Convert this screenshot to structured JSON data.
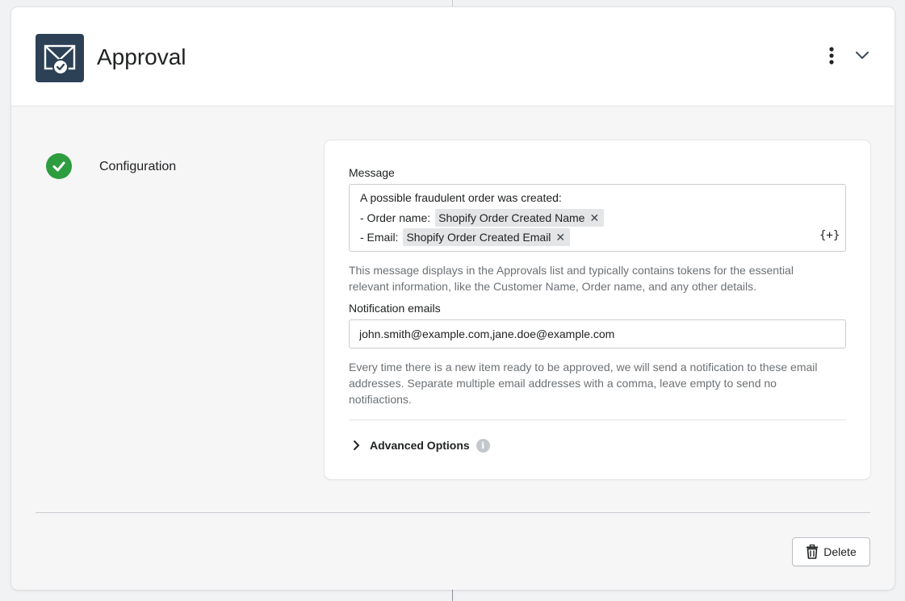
{
  "header": {
    "title": "Approval",
    "app_icon": "approval-envelope-icon",
    "menu_icon": "vertical-dots-icon",
    "collapse_icon": "chevron-down-icon"
  },
  "step": {
    "label": "Configuration",
    "status_icon": "check-circle-icon",
    "status_color": "#2d9d3f"
  },
  "message": {
    "label": "Message",
    "line1": "A possible fraudulent order was created:",
    "line2_prefix": "- Order name:",
    "line2_token": "Shopify Order Created Name",
    "line3_prefix": "- Email:",
    "line3_token": "Shopify Order Created Email",
    "token_remove_glyph": "✕",
    "insert_token_label": "{+}",
    "help_line1": "This message displays in the Approvals list and typically contains tokens for the essential",
    "help_line2": "relevant information, like the Customer Name, Order name, and any other details."
  },
  "notification": {
    "label": "Notification emails",
    "value": "john.smith@example.com,jane.doe@example.com",
    "help_line1": "Every time there is a new item ready to be approved, we will send a notification to these email",
    "help_line2": "addresses. Separate multiple email addresses with a comma, leave empty to send no",
    "help_line3": "notifiactions."
  },
  "advanced": {
    "label": "Advanced Options",
    "info_glyph": "i"
  },
  "footer": {
    "delete_label": "Delete",
    "delete_icon": "trash-icon"
  }
}
